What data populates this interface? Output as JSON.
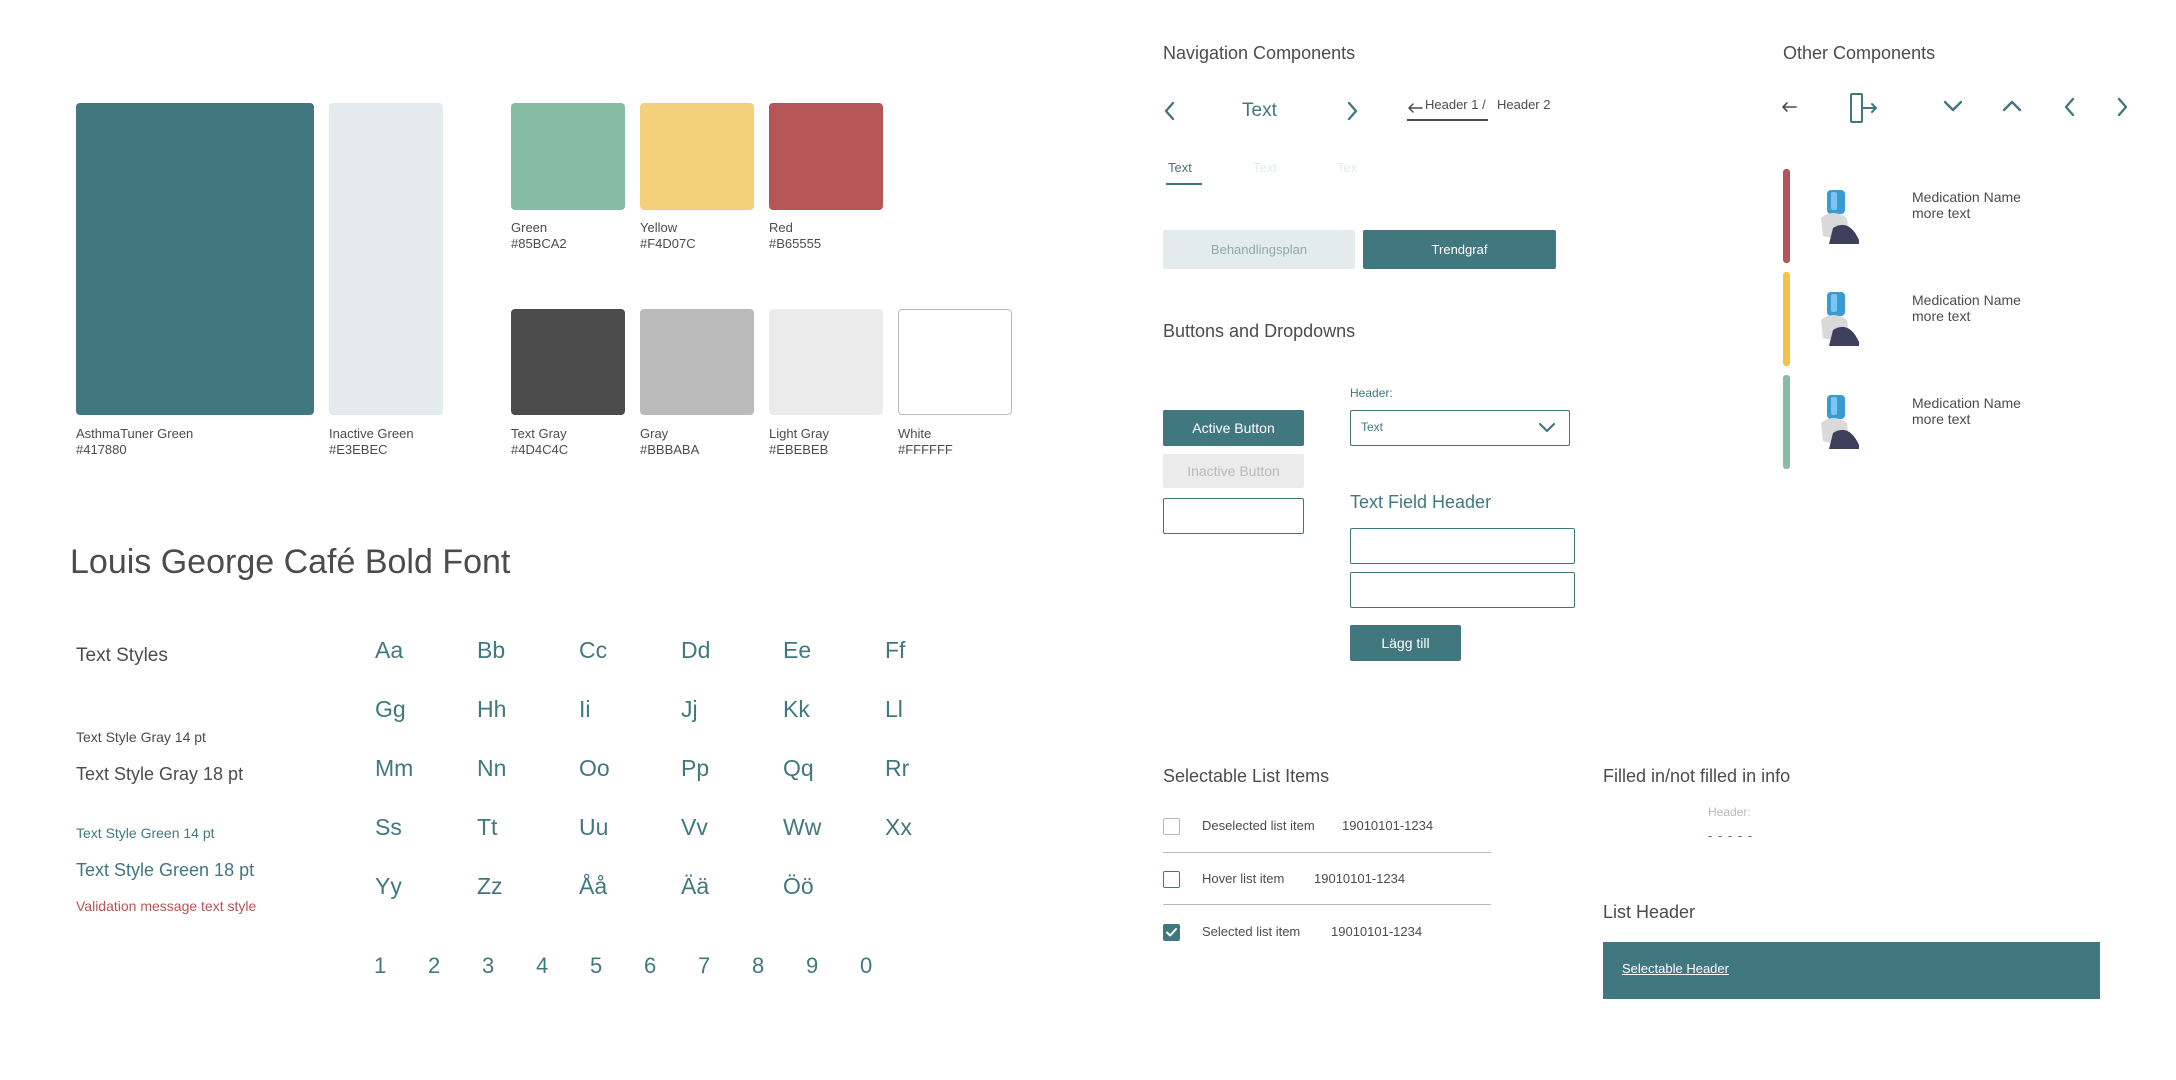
{
  "colors": {
    "primary": [
      {
        "name": "AsthmaTuner Green",
        "hex": "#417880"
      },
      {
        "name": "Inactive Green",
        "hex": "#E3EBEC"
      }
    ],
    "status": [
      {
        "name": "Green",
        "hex": "#85BCA2"
      },
      {
        "name": "Yellow",
        "hex": "#F4D07C"
      },
      {
        "name": "Red",
        "hex": "#B65555"
      }
    ],
    "neutral": [
      {
        "name": "Text Gray",
        "hex": "#4D4C4C"
      },
      {
        "name": "Gray",
        "hex": "#BBBABA"
      },
      {
        "name": "Light Gray",
        "hex": "#EBEBEB"
      },
      {
        "name": "White",
        "hex": "#FFFFFF"
      }
    ]
  },
  "typography": {
    "font_title": "Louis George Café Bold Font",
    "styles_title": "Text Styles",
    "style_gray_14": "Text Style Gray 14 pt",
    "style_gray_18": "Text Style Gray 18 pt",
    "style_green_14": "Text Style Green 14 pt",
    "style_green_18": "Text Style Green 18 pt",
    "validation": "Validation message text style",
    "letters": [
      "Aa",
      "Bb",
      "Cc",
      "Dd",
      "Ee",
      "Ff",
      "Gg",
      "Hh",
      "Ii",
      "Jj",
      "Kk",
      "Ll",
      "Mm",
      "Nn",
      "Oo",
      "Pp",
      "Qq",
      "Rr",
      "Ss",
      "Tt",
      "Uu",
      "Vv",
      "Ww",
      "Xx",
      "Yy",
      "Zz",
      "Åå",
      "Ää",
      "Öö"
    ],
    "digits": [
      "1",
      "2",
      "3",
      "4",
      "5",
      "6",
      "7",
      "8",
      "9",
      "0"
    ]
  },
  "navigation": {
    "title": "Navigation Components",
    "nav_text": "Text",
    "breadcrumb_1": "Header 1 /",
    "breadcrumb_2": "Header 2",
    "tabs": [
      "Text",
      "Text",
      "Tex"
    ],
    "segment_inactive": "Behandlingsplan",
    "segment_active": "Trendgraf"
  },
  "other": {
    "title": "Other Components",
    "back_arrow": "←",
    "medications": [
      {
        "name": "Medication Name",
        "sub": "more text",
        "color": "#B65555"
      },
      {
        "name": "Medication Name",
        "sub": "more text",
        "color": "#F4C14A"
      },
      {
        "name": "Medication Name",
        "sub": "more text",
        "color": "#85BCA2"
      }
    ]
  },
  "buttons": {
    "title": "Buttons and Dropdowns",
    "active": "Active Button",
    "inactive": "Inactive Button",
    "dropdown_header": "Header:",
    "dropdown_value": "Text",
    "text_field_header": "Text Field Header",
    "add_button": "Lägg till"
  },
  "selectable": {
    "title": "Selectable List Items",
    "items": [
      {
        "label": "Deselected list item",
        "id": "19010101-1234"
      },
      {
        "label": "Hover list item",
        "id": "19010101-1234"
      },
      {
        "label": "Selected list item",
        "id": "19010101-1234"
      }
    ]
  },
  "filled_info": {
    "title": "Filled in/not filled in info",
    "header": "Header:",
    "placeholder": "- - - - -"
  },
  "list_header": {
    "title": "List Header",
    "selectable_header": "Selectable Header"
  }
}
